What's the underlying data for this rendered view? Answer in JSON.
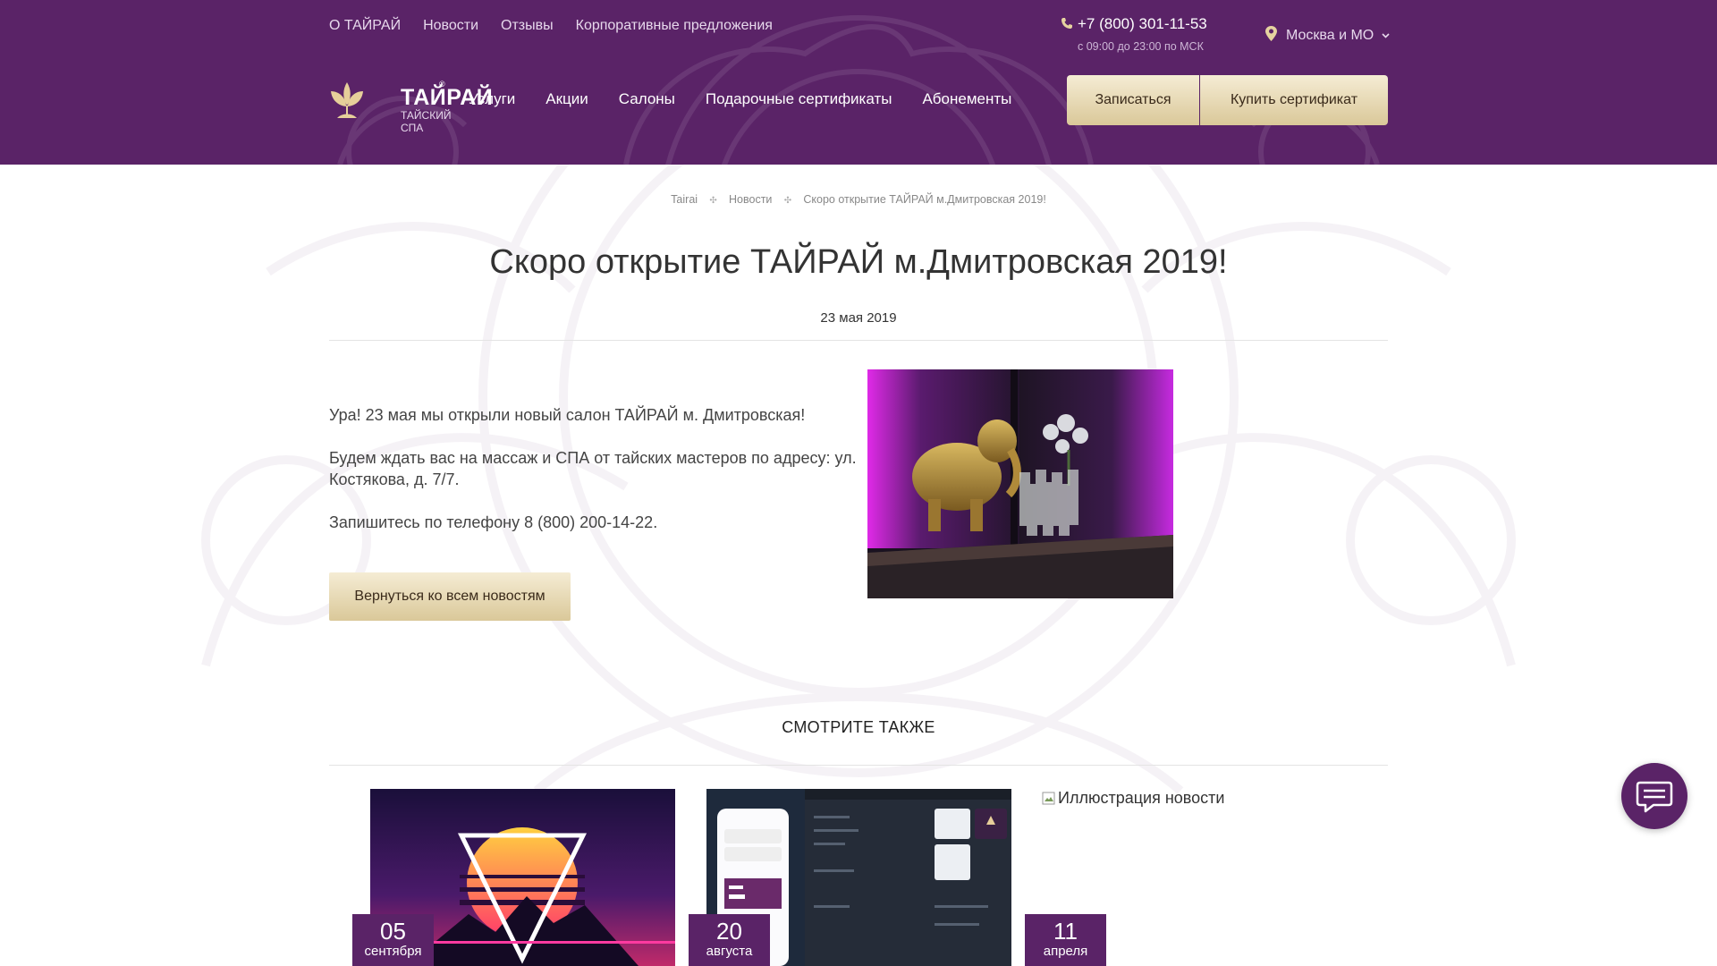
{
  "topnav": [
    "О ТАЙРАЙ",
    "Новости",
    "Отзывы",
    "Корпоративные предложения"
  ],
  "contact": {
    "phone": "+7 (800) 301-11-53",
    "hours": "с 09:00 до 23:00 по МСК",
    "region": "Москва и МО"
  },
  "logo": {
    "title": "ТАЙРАЙ",
    "reg": "®",
    "subtitle": "ТАЙСКИЙ СПА"
  },
  "mainnav": [
    "Услуги",
    "Акции",
    "Салоны",
    "Подарочные сертификаты",
    "Абонементы"
  ],
  "header_buttons": {
    "book": "Записаться",
    "buy_certificate": "Купить сертификат"
  },
  "breadcrumb": [
    "Tairai",
    "Новости",
    "Скоро открытие ТАЙРАЙ м.Дмитровская 2019!"
  ],
  "article": {
    "title": "Скоро открытие ТАЙРАЙ м.Дмитровская 2019!",
    "date": "23 мая 2019",
    "paragraphs": [
      "Ура! 23 мая мы открыли новый салон ТАЙРАЙ м. Дмитровская!",
      "Будем ждать вас на массаж и СПА от тайских мастеров по адресу: ул. Костякова, д. 7/7.",
      "Запишитесь по телефону 8 (800) 200-14-22."
    ],
    "back_button": "Вернуться ко всем новостям"
  },
  "see_also": {
    "heading": "СМОТРИТЕ ТАКЖЕ",
    "cards": [
      {
        "day": "05",
        "month": "сентября"
      },
      {
        "day": "20",
        "month": "августа"
      },
      {
        "day": "11",
        "month": "апреля",
        "image_alt": "Иллюстрация новости"
      }
    ]
  },
  "colors": {
    "brand_purple": "#5a2367",
    "gold_light": "#f5ecd4",
    "gold_dark": "#dac899"
  },
  "icons": [
    "phone-icon",
    "location-pin-icon",
    "chevron-down-icon",
    "lotus-logo-icon",
    "breadcrumb-separator-icon",
    "chat-icon",
    "broken-image-icon"
  ]
}
